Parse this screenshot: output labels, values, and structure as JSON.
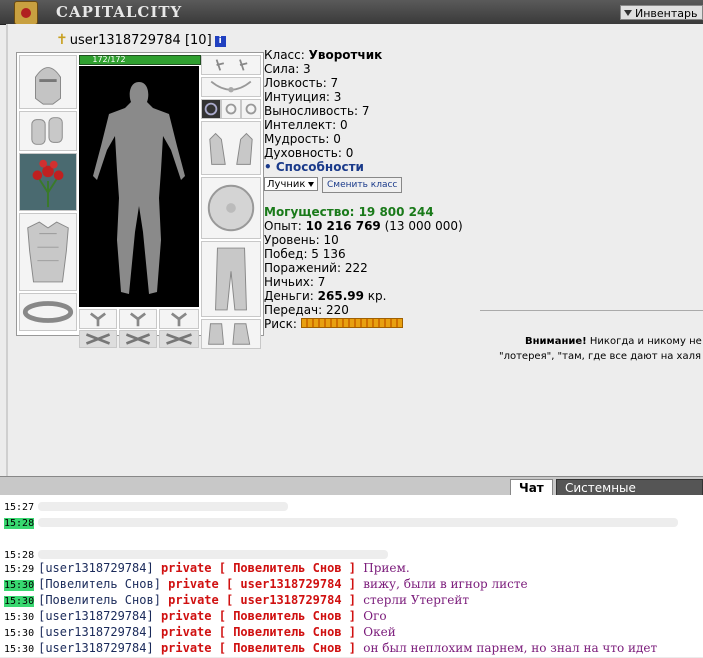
{
  "header": {
    "logo_text": "CAPITALCITY",
    "inventory_tab": "Инвентарь"
  },
  "character": {
    "name": "user1318729784",
    "level": "[10]",
    "hp": "172/172"
  },
  "stats": {
    "class_label": "Класс: ",
    "class_value": "Уворотчик",
    "lines": [
      "Сила: 3",
      "Ловкость: 7",
      "Интуиция: 3",
      "Выносливость: 7",
      "Интеллект: 0",
      "Мудрость: 0",
      "Духовность: 0"
    ],
    "abilities": "• Способности",
    "class_select": "Лучник",
    "change_class": "Сменить класс",
    "power": "Могущество: 19 800 244",
    "exp_label": "Опыт: ",
    "exp_value": "10 216 769",
    "exp_next": " (13 000 000)",
    "lines2": [
      "Уровень: 10",
      "Побед: 5 136",
      "Поражений: 222",
      "Ничьих: 7"
    ],
    "money_label": "Деньги: ",
    "money_value": "265.99",
    "money_unit": " кр.",
    "transfers": "Передач: 220",
    "risk": "Риск:"
  },
  "warning": {
    "title": "Внимание!",
    "text1": " Никогда и никому не",
    "text2": "\"лотерея\", \"там, где все дают на халя"
  },
  "chat": {
    "tabs": [
      "Чат",
      "Системные сообщения"
    ],
    "blurred_times": [
      "15:27",
      "15:28",
      "15:28"
    ],
    "messages": [
      {
        "time": "15:29",
        "from": "[user1318729784]",
        "private_label": "private",
        "to": "[ Повелитель Снов ]",
        "text": "Прием."
      },
      {
        "time": "15:30",
        "from": "[Повелитель Снов]",
        "private_label": "private",
        "to": "[ user1318729784 ]",
        "text": "вижу, были в игнор листе"
      },
      {
        "time": "15:30",
        "from": "[Повелитель Снов]",
        "private_label": "private",
        "to": "[ user1318729784 ]",
        "text": "стерли Утергейт"
      },
      {
        "time": "15:30",
        "from": "[user1318729784]",
        "private_label": "private",
        "to": "[ Повелитель Снов ]",
        "text": "Ого"
      },
      {
        "time": "15:30",
        "from": "[user1318729784]",
        "private_label": "private",
        "to": "[ Повелитель Снов ]",
        "text": "Окей"
      },
      {
        "time": "15:30",
        "from": "[user1318729784]",
        "private_label": "private",
        "to": "[ Повелитель Снов ]",
        "text": "он был неплохим парнем, но знал на что идет"
      }
    ]
  },
  "colors": {
    "power": "#1a7a1a",
    "private": "#d01010",
    "highlight": "#38d870",
    "message": "#7a1a7a"
  }
}
